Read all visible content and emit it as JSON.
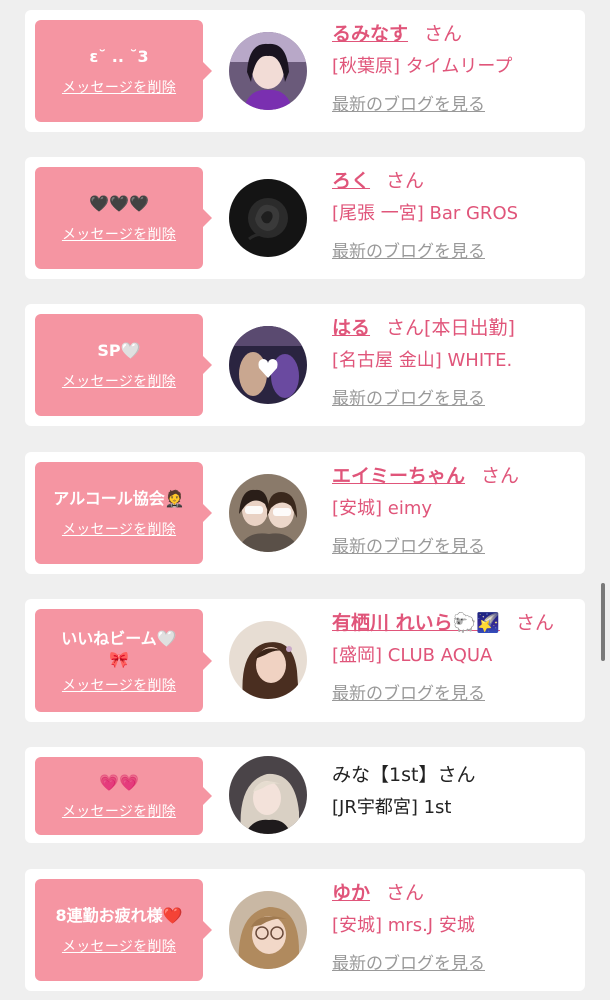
{
  "delete_label": "メッセージを削除",
  "blog_label": "最新のブログを見る",
  "colors": {
    "accent": "#e0557a",
    "bubble": "#f595a2",
    "card": "#ffffff",
    "background": "#efefef"
  },
  "items": [
    {
      "message": "ε˘ .. ˘3",
      "name": "るみなす",
      "honorific": "さん",
      "status": "",
      "shop": "[秋葉原] タイムリープ",
      "has_blog": true,
      "avatar": "avatar-girl-purple"
    },
    {
      "message": "🖤🖤🖤",
      "name": "ろく",
      "honorific": "さん",
      "status": "",
      "shop": "[尾張 一宮] Bar GROS",
      "has_blog": true,
      "avatar": "avatar-black-rose"
    },
    {
      "message": "SP🤍",
      "name": "はる",
      "honorific": "さん",
      "status": "[本日出勤]",
      "shop": "[名古屋 金山] WHITE.",
      "has_blog": true,
      "avatar": "avatar-heart-selfie"
    },
    {
      "message": "アルコール協会🤵",
      "name": "エイミーちゃん",
      "honorific": "さん",
      "status": "",
      "shop": "[安城] eimy",
      "has_blog": true,
      "avatar": "avatar-two-girls"
    },
    {
      "message": "いいねビーム🤍",
      "message2": "🎀",
      "name": "有栖川 れいら🐑🌠",
      "honorific": "さん",
      "status": "",
      "shop": "[盛岡] CLUB AQUA",
      "has_blog": true,
      "avatar": "avatar-brown-hair"
    },
    {
      "message": "💗💗",
      "name": "みな【1st】",
      "honorific": "さん",
      "status": "",
      "shop": "[JR宇都宮] 1st",
      "has_blog": false,
      "avatar": "avatar-blonde"
    },
    {
      "message": "8連勤お疲れ様❤️",
      "name": "ゆか",
      "honorific": "さん",
      "status": "",
      "shop": "[安城] mrs.J 安城",
      "has_blog": true,
      "avatar": "avatar-glasses-girl"
    }
  ]
}
